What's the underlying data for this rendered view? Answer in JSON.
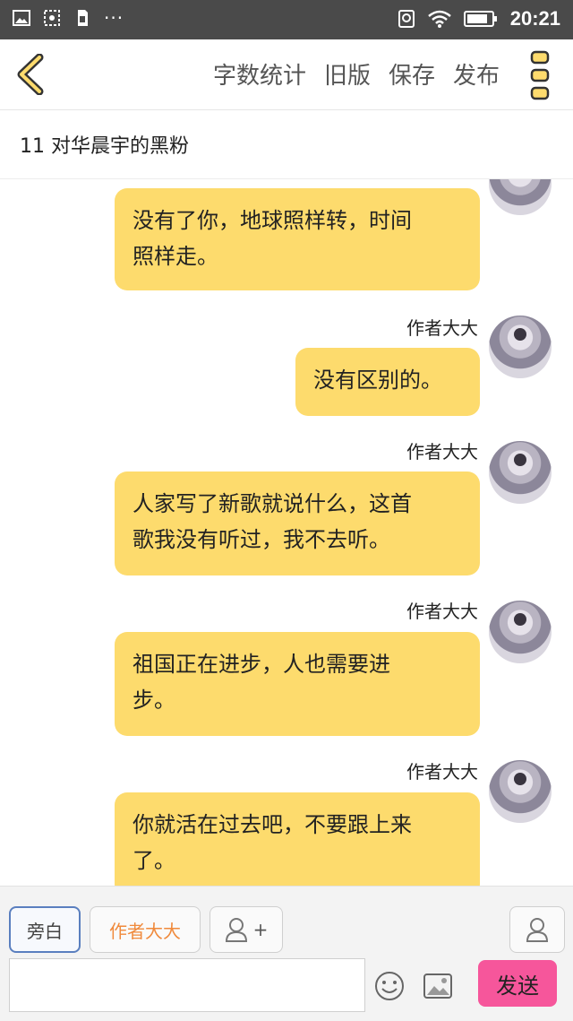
{
  "status_bar": {
    "time": "20:21",
    "icons": [
      "image-icon",
      "photo-icon",
      "sim-icon",
      "more-dots-icon",
      "location-icon",
      "wifi-icon",
      "battery-icon"
    ],
    "dots": "···"
  },
  "top_bar": {
    "back_icon": "chevron-left-icon",
    "actions": [
      "字数统计",
      "旧版",
      "保存",
      "发布"
    ],
    "more_icon": "vertical-dots-icon"
  },
  "chapter": {
    "title": "11  对华晨宇的黑粉"
  },
  "messages": [
    {
      "author": "",
      "text_lines": [
        "没有了你，地球照样转，时间",
        "照样走。"
      ]
    },
    {
      "author": "作者大大",
      "text_lines": [
        "没有区别的。"
      ]
    },
    {
      "author": "作者大大",
      "text_lines": [
        "人家写了新歌就说什么，这首",
        "歌我没有听过，我不去听。"
      ]
    },
    {
      "author": "作者大大",
      "text_lines": [
        "祖国正在进步，人也需要进",
        "步。"
      ]
    },
    {
      "author": "作者大大",
      "text_lines": [
        "你就活在过去吧，不要跟上来",
        "了。"
      ]
    }
  ],
  "bottom_bar": {
    "roles": {
      "aside": "旁白",
      "author": "作者大大",
      "add_symbol": "+"
    },
    "input_placeholder": "",
    "send_label": "发送",
    "icons": [
      "person-add-icon",
      "person-icon",
      "emoji-icon",
      "image-icon"
    ]
  },
  "colors": {
    "bubble": "#fddb6d",
    "send_button": "#f6569b",
    "status_bar": "#4a4a4a",
    "author_role": "#f08a3c"
  }
}
